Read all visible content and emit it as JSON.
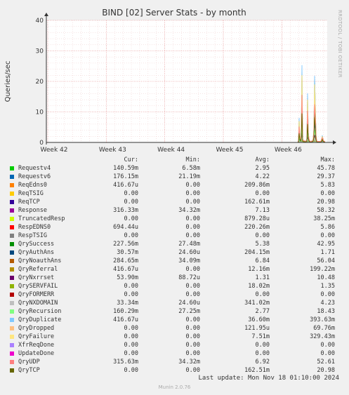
{
  "chart_data": {
    "type": "line",
    "title": "BIND [02] Server Stats - by month",
    "ylabel": "Queries/sec",
    "ylim": [
      0,
      40
    ],
    "y_ticks": [
      "0",
      "10",
      "20",
      "30",
      "40"
    ],
    "x_ticks": [
      "Week 42",
      "Week 43",
      "Week 44",
      "Week 45",
      "Week 46"
    ],
    "grid": true,
    "legend_headers": {
      "cur": "Cur:",
      "min": "Min:",
      "avg": "Avg:",
      "max": "Max:"
    },
    "series": [
      {
        "name": "Requestv4",
        "color": "#00cc00",
        "cur": "140.59m",
        "min": "6.58m",
        "avg": "2.95",
        "max": "45.78"
      },
      {
        "name": "Requestv6",
        "color": "#0066b3",
        "cur": "176.15m",
        "min": "21.19m",
        "avg": "4.22",
        "max": "29.37"
      },
      {
        "name": "ReqEdns0",
        "color": "#ff8000",
        "cur": "416.67u",
        "min": "0.00",
        "avg": "209.86m",
        "max": "5.83"
      },
      {
        "name": "ReqTSIG",
        "color": "#ffcc00",
        "cur": "0.00",
        "min": "0.00",
        "avg": "0.00",
        "max": "0.00"
      },
      {
        "name": "ReqTCP",
        "color": "#330099",
        "cur": "0.00",
        "min": "0.00",
        "avg": "162.61m",
        "max": "20.98"
      },
      {
        "name": "Response",
        "color": "#990099",
        "cur": "316.33m",
        "min": "34.32m",
        "avg": "7.13",
        "max": "58.32"
      },
      {
        "name": "TruncatedResp",
        "color": "#ccff00",
        "cur": "0.00",
        "min": "0.00",
        "avg": "879.28u",
        "max": "38.25m"
      },
      {
        "name": "RespEDNS0",
        "color": "#ff0000",
        "cur": "694.44u",
        "min": "0.00",
        "avg": "220.26m",
        "max": "5.86"
      },
      {
        "name": "RespTSIG",
        "color": "#808080",
        "cur": "0.00",
        "min": "0.00",
        "avg": "0.00",
        "max": "0.00"
      },
      {
        "name": "QrySuccess",
        "color": "#008f00",
        "cur": "227.56m",
        "min": "27.48m",
        "avg": "5.38",
        "max": "42.95"
      },
      {
        "name": "QryAuthAns",
        "color": "#00487d",
        "cur": "30.57m",
        "min": "24.60u",
        "avg": "204.15m",
        "max": "1.71"
      },
      {
        "name": "QryNoauthAns",
        "color": "#b35a00",
        "cur": "284.65m",
        "min": "34.09m",
        "avg": "6.84",
        "max": "56.04"
      },
      {
        "name": "QryReferral",
        "color": "#b38f00",
        "cur": "416.67u",
        "min": "0.00",
        "avg": "12.16m",
        "max": "199.22m"
      },
      {
        "name": "QryNxrrset",
        "color": "#6b006b",
        "cur": "53.90m",
        "min": "88.72u",
        "avg": "1.31",
        "max": "10.48"
      },
      {
        "name": "QrySERVFAIL",
        "color": "#8fb300",
        "cur": "0.00",
        "min": "0.00",
        "avg": "18.02m",
        "max": "1.35"
      },
      {
        "name": "QryFORMERR",
        "color": "#b30000",
        "cur": "0.00",
        "min": "0.00",
        "avg": "0.00",
        "max": "0.00"
      },
      {
        "name": "QryNXDOMAIN",
        "color": "#bebebe",
        "cur": "33.34m",
        "min": "24.60u",
        "avg": "341.02m",
        "max": "4.23"
      },
      {
        "name": "QryRecursion",
        "color": "#80ff80",
        "cur": "160.29m",
        "min": "27.25m",
        "avg": "2.77",
        "max": "18.43"
      },
      {
        "name": "QryDuplicate",
        "color": "#80c9ff",
        "cur": "416.67u",
        "min": "0.00",
        "avg": "36.60m",
        "max": "393.63m"
      },
      {
        "name": "QryDropped",
        "color": "#ffc080",
        "cur": "0.00",
        "min": "0.00",
        "avg": "121.95u",
        "max": "69.76m"
      },
      {
        "name": "QryFailure",
        "color": "#ffe680",
        "cur": "0.00",
        "min": "0.00",
        "avg": "7.51m",
        "max": "329.43m"
      },
      {
        "name": "XfrReqDone",
        "color": "#aa80ff",
        "cur": "0.00",
        "min": "0.00",
        "avg": "0.00",
        "max": "0.00"
      },
      {
        "name": "UpdateDone",
        "color": "#ee00cc",
        "cur": "0.00",
        "min": "0.00",
        "avg": "0.00",
        "max": "0.00"
      },
      {
        "name": "QryUDP",
        "color": "#ff8080",
        "cur": "315.63m",
        "min": "34.32m",
        "avg": "6.92",
        "max": "52.61"
      },
      {
        "name": "QryTCP",
        "color": "#666600",
        "cur": "0.00",
        "min": "0.00",
        "avg": "162.51m",
        "max": "20.98"
      }
    ]
  },
  "last_update": "Last update: Mon Nov 18 01:10:00 2024",
  "footer": "Munin 2.0.76",
  "side_label": "RRDTOOL / TOBI OETIKER"
}
